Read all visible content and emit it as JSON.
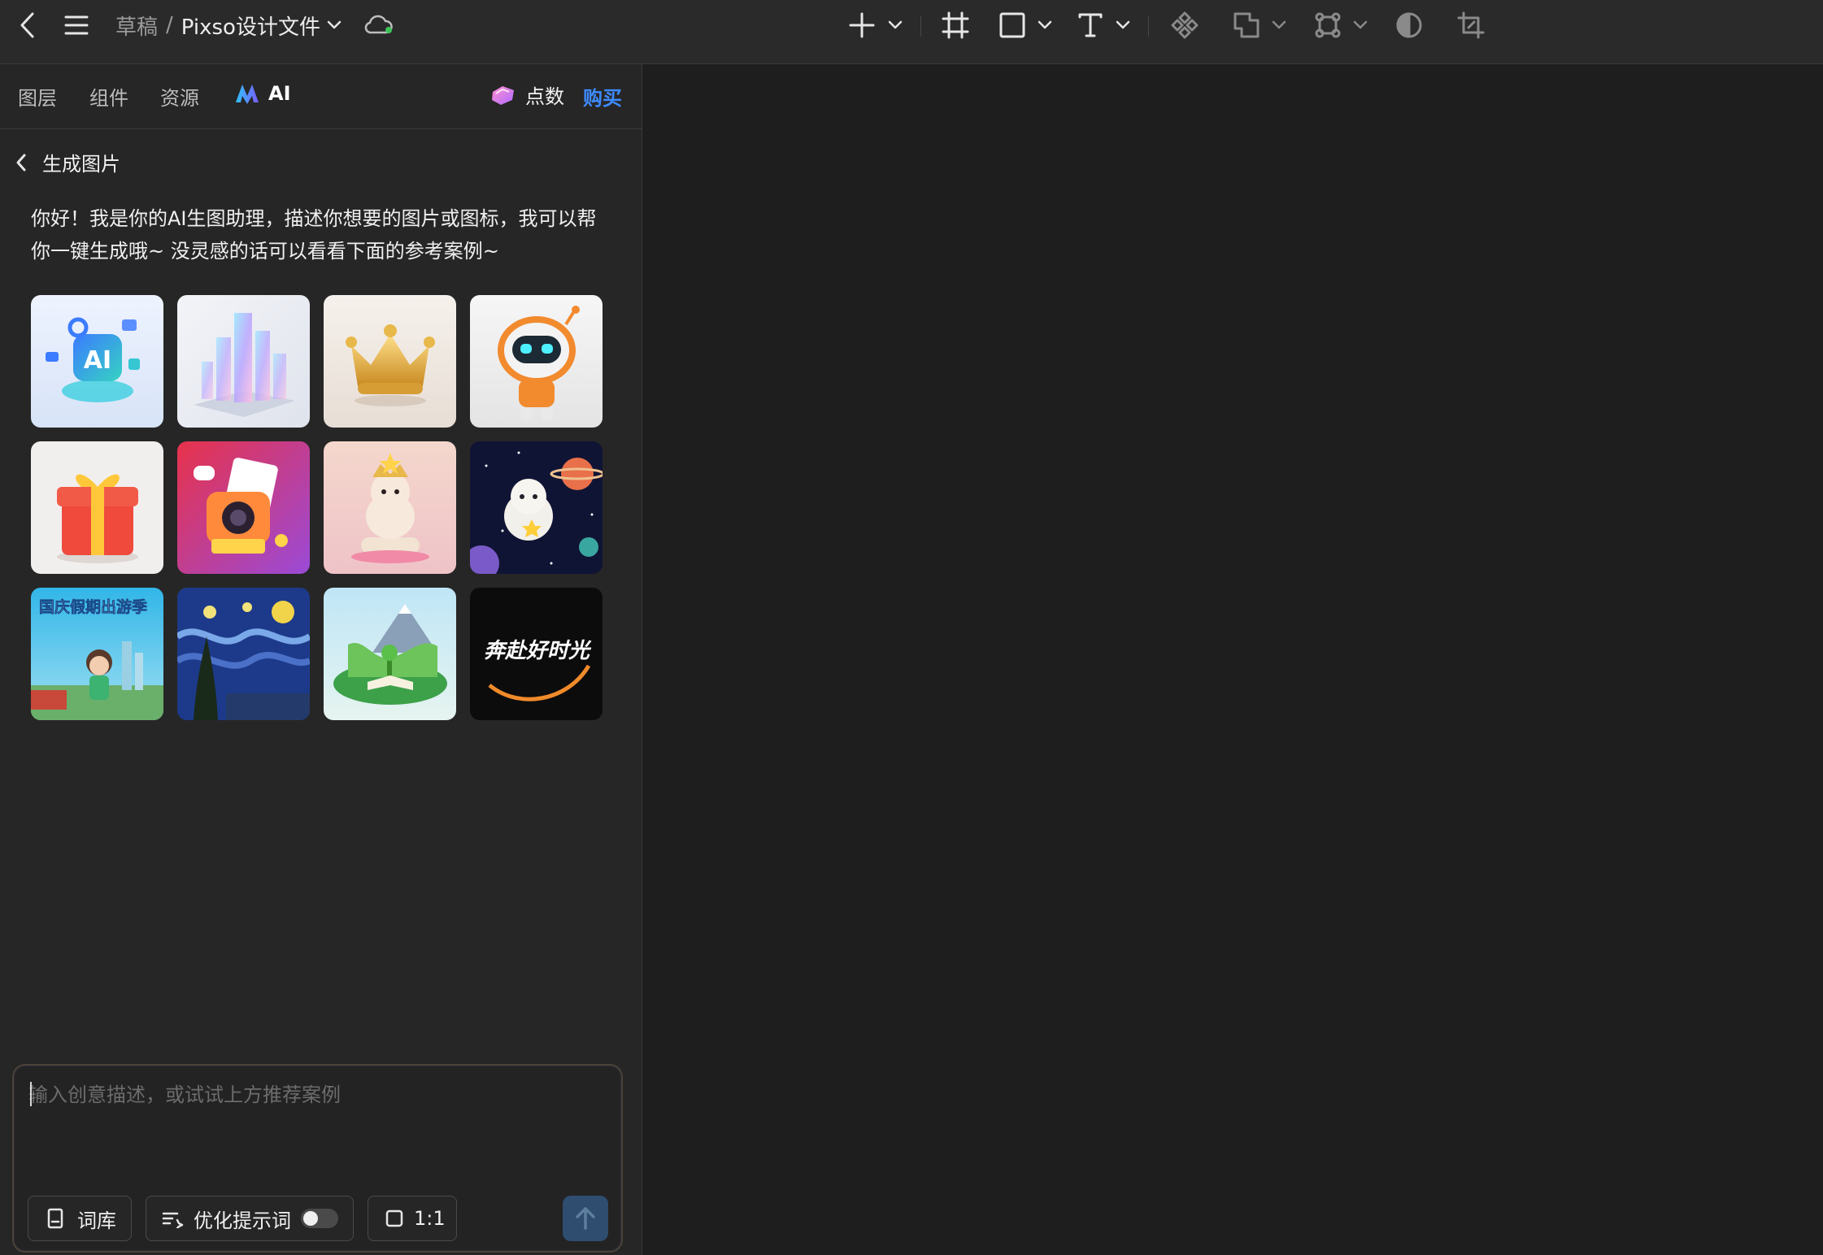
{
  "breadcrumb": {
    "parent": "草稿",
    "separator": "/",
    "file_name": "Pixso设计文件"
  },
  "panel_tabs": {
    "layers": "图层",
    "components": "组件",
    "assets": "资源",
    "ai": "AI"
  },
  "points": {
    "label": "点数",
    "buy_label": "购买"
  },
  "page": {
    "title": "生成图片",
    "greeting": "你好！我是你的AI生图助理，描述你想要的图片或图标，我可以帮你一键生成哦~ 没灵感的话可以看看下面的参考案例~"
  },
  "examples": [
    {
      "name": "ai-3d-icon",
      "label": "AI"
    },
    {
      "name": "glass-city",
      "label": ""
    },
    {
      "name": "gold-crown",
      "label": ""
    },
    {
      "name": "orange-robot",
      "label": ""
    },
    {
      "name": "gift-box",
      "label": ""
    },
    {
      "name": "pink-camera",
      "label": ""
    },
    {
      "name": "puppy-trophy",
      "label": ""
    },
    {
      "name": "astronaut-space",
      "label": ""
    },
    {
      "name": "national-day-travel",
      "label": "国庆假期出游季"
    },
    {
      "name": "starry-night",
      "label": ""
    },
    {
      "name": "green-island-book",
      "label": ""
    },
    {
      "name": "calligraphy-poster",
      "label": "奔赴好时光"
    }
  ],
  "prompt": {
    "placeholder": "输入创意描述，或试试上方推荐案例",
    "value": "",
    "dictionary_label": "词库",
    "optimize_label": "优化提示词",
    "optimize_on": false,
    "ratio_label": "1:1"
  },
  "colors": {
    "accent_blue": "#3d8bff",
    "send_button": "#2f4d6f",
    "status_dot": "#3ec45a"
  },
  "icons": {
    "back": "chevron-left-icon",
    "menu": "hamburger-menu-icon",
    "cloud": "cloud-sync-icon",
    "add": "plus-icon",
    "frame": "frame-icon",
    "shape": "rectangle-icon",
    "text": "text-icon",
    "component": "component-icon",
    "boolean": "boolean-union-icon",
    "vector": "vector-network-icon",
    "mask": "mask-icon",
    "crop": "crop-icon"
  }
}
